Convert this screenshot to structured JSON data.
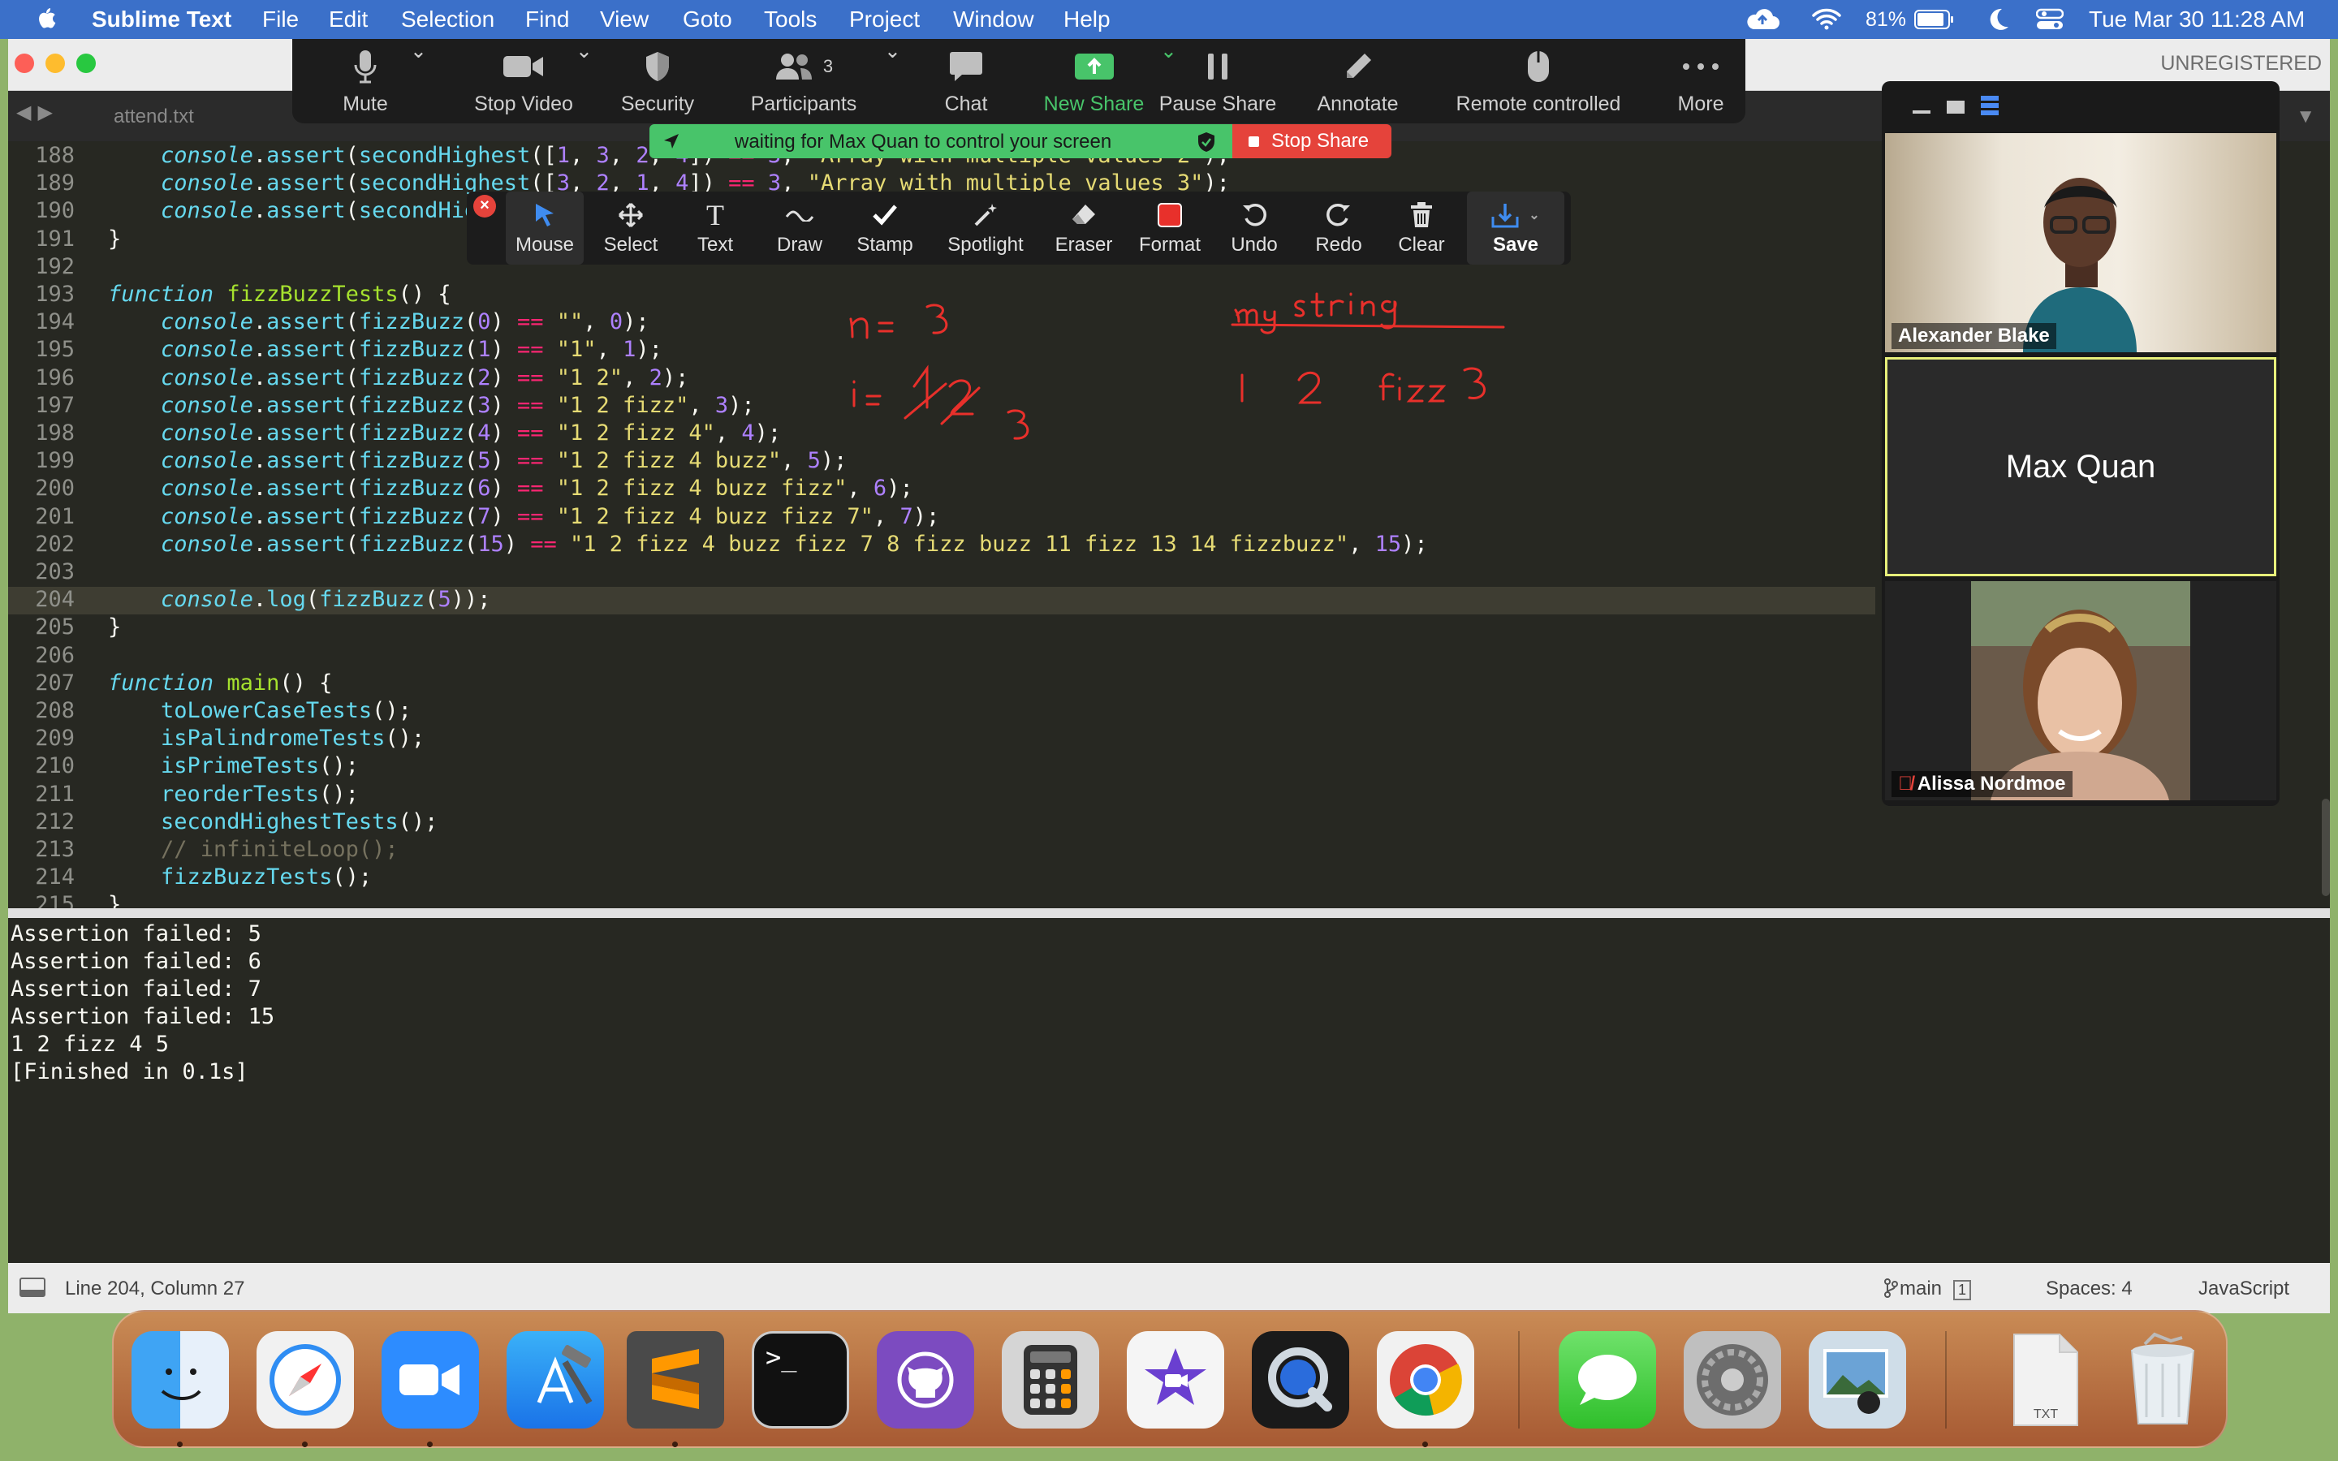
{
  "menubar": {
    "app": "Sublime Text",
    "items": [
      "File",
      "Edit",
      "Selection",
      "Find",
      "View",
      "Goto",
      "Tools",
      "Project",
      "Window",
      "Help"
    ],
    "battery": "81%",
    "datetime": "Tue Mar 30  11:28 AM"
  },
  "window": {
    "unregistered": "UNREGISTERED",
    "tab": "attend.txt"
  },
  "zoom_toolbar": {
    "mute": "Mute",
    "stop_video": "Stop Video",
    "security": "Security",
    "participants": "Participants",
    "participants_count": "3",
    "chat": "Chat",
    "new_share": "New Share",
    "pause_share": "Pause Share",
    "annotate": "Annotate",
    "remote_controlled": "Remote controlled",
    "more": "More"
  },
  "share_banner": {
    "waiting": "waiting for Max Quan to control your screen",
    "stop_share": "Stop Share"
  },
  "annotation_toolbar": {
    "mouse": "Mouse",
    "select": "Select",
    "text": "Text",
    "draw": "Draw",
    "stamp": "Stamp",
    "spotlight": "Spotlight",
    "eraser": "Eraser",
    "format": "Format",
    "undo": "Undo",
    "redo": "Redo",
    "clear": "Clear",
    "save": "Save"
  },
  "editor": {
    "lines": [
      {
        "n": "188",
        "html": "    <span class=\"kw\">console</span>.<span class=\"id\">assert</span>(<span class=\"id\">secondHighest</span>([<span class=\"num\">1</span>, <span class=\"num\">3</span>, <span class=\"num\">2</span>, <span class=\"num\">4</span>]) <span class=\"op\">==</span> <span class=\"num\">3</span>, <span class=\"str\">\"Array with multiple values 2\"</span>);"
      },
      {
        "n": "189",
        "html": "    <span class=\"kw\">console</span>.<span class=\"id\">assert</span>(<span class=\"id\">secondHighest</span>([<span class=\"num\">3</span>, <span class=\"num\">2</span>, <span class=\"num\">1</span>, <span class=\"num\">4</span>]) <span class=\"op\">==</span> <span class=\"num\">3</span>, <span class=\"str\">\"Array with multiple values 3\"</span>);"
      },
      {
        "n": "190",
        "html": "    <span class=\"kw\">console</span>.<span class=\"id\">assert</span>(<span class=\"id\">secondHighest</span>([<span class=\"num\">1</span>, <span class=\"num\">1</span>]) <span class=\"op\">==</span> <span class=\"num\">1</span>);"
      },
      {
        "n": "191",
        "html": "}"
      },
      {
        "n": "192",
        "html": ""
      },
      {
        "n": "193",
        "html": "<span class=\"kw\">function</span> <span class=\"fn\">fizzBuzzTests</span>() {"
      },
      {
        "n": "194",
        "html": "    <span class=\"kw\">console</span>.<span class=\"id\">assert</span>(<span class=\"id\">fizzBuzz</span>(<span class=\"num\">0</span>) <span class=\"op\">==</span> <span class=\"str\">\"\"</span>, <span class=\"num\">0</span>);"
      },
      {
        "n": "195",
        "html": "    <span class=\"kw\">console</span>.<span class=\"id\">assert</span>(<span class=\"id\">fizzBuzz</span>(<span class=\"num\">1</span>) <span class=\"op\">==</span> <span class=\"str\">\"1\"</span>, <span class=\"num\">1</span>);"
      },
      {
        "n": "196",
        "html": "    <span class=\"kw\">console</span>.<span class=\"id\">assert</span>(<span class=\"id\">fizzBuzz</span>(<span class=\"num\">2</span>) <span class=\"op\">==</span> <span class=\"str\">\"1 2\"</span>, <span class=\"num\">2</span>);"
      },
      {
        "n": "197",
        "html": "    <span class=\"kw\">console</span>.<span class=\"id\">assert</span>(<span class=\"id\">fizzBuzz</span>(<span class=\"num\">3</span>) <span class=\"op\">==</span> <span class=\"str\">\"1 2 fizz\"</span>, <span class=\"num\">3</span>);"
      },
      {
        "n": "198",
        "html": "    <span class=\"kw\">console</span>.<span class=\"id\">assert</span>(<span class=\"id\">fizzBuzz</span>(<span class=\"num\">4</span>) <span class=\"op\">==</span> <span class=\"str\">\"1 2 fizz 4\"</span>, <span class=\"num\">4</span>);"
      },
      {
        "n": "199",
        "html": "    <span class=\"kw\">console</span>.<span class=\"id\">assert</span>(<span class=\"id\">fizzBuzz</span>(<span class=\"num\">5</span>) <span class=\"op\">==</span> <span class=\"str\">\"1 2 fizz 4 buzz\"</span>, <span class=\"num\">5</span>);"
      },
      {
        "n": "200",
        "html": "    <span class=\"kw\">console</span>.<span class=\"id\">assert</span>(<span class=\"id\">fizzBuzz</span>(<span class=\"num\">6</span>) <span class=\"op\">==</span> <span class=\"str\">\"1 2 fizz 4 buzz fizz\"</span>, <span class=\"num\">6</span>);"
      },
      {
        "n": "201",
        "html": "    <span class=\"kw\">console</span>.<span class=\"id\">assert</span>(<span class=\"id\">fizzBuzz</span>(<span class=\"num\">7</span>) <span class=\"op\">==</span> <span class=\"str\">\"1 2 fizz 4 buzz fizz 7\"</span>, <span class=\"num\">7</span>);"
      },
      {
        "n": "202",
        "html": "    <span class=\"kw\">console</span>.<span class=\"id\">assert</span>(<span class=\"id\">fizzBuzz</span>(<span class=\"num\">15</span>) <span class=\"op\">==</span> <span class=\"str\">\"1 2 fizz 4 buzz fizz 7 8 fizz buzz 11 fizz 13 14 fizzbuzz\"</span>, <span class=\"num\">15</span>);"
      },
      {
        "n": "203",
        "html": ""
      },
      {
        "n": "204",
        "html": "    <span class=\"kw\">console</span>.<span class=\"id\">log</span>(<span class=\"id\">fizzBuzz</span>(<span class=\"num\">5</span>));",
        "current": true
      },
      {
        "n": "205",
        "html": "}"
      },
      {
        "n": "206",
        "html": ""
      },
      {
        "n": "207",
        "html": "<span class=\"kw\">function</span> <span class=\"fn\">main</span>() {"
      },
      {
        "n": "208",
        "html": "    <span class=\"id\">toLowerCaseTests</span>();"
      },
      {
        "n": "209",
        "html": "    <span class=\"id\">isPalindromeTests</span>();"
      },
      {
        "n": "210",
        "html": "    <span class=\"id\">isPrimeTests</span>();"
      },
      {
        "n": "211",
        "html": "    <span class=\"id\">reorderTests</span>();"
      },
      {
        "n": "212",
        "html": "    <span class=\"id\">secondHighestTests</span>();"
      },
      {
        "n": "213",
        "html": "    <span class=\"cm\">// infiniteLoop();</span>"
      },
      {
        "n": "214",
        "html": "    <span class=\"id\">fizzBuzzTests</span>();"
      },
      {
        "n": "215",
        "html": "}"
      }
    ]
  },
  "console": {
    "lines": [
      "Assertion failed: 5",
      "Assertion failed: 6",
      "Assertion failed: 7",
      "Assertion failed: 15",
      "1 2 fizz 4 5",
      "[Finished in 0.1s]"
    ]
  },
  "statusbar": {
    "position": "Line 204, Column 27",
    "branch": "main",
    "branch_count": "1",
    "spaces": "Spaces: 4",
    "syntax": "JavaScript"
  },
  "annotations": {
    "n_eq": "n = 3",
    "i_eq": "i = 1 2 3",
    "my_string": "my string",
    "seq": "1  2  fizz3"
  },
  "participants": [
    {
      "name": "Alexander Blake"
    },
    {
      "name": "Max Quan"
    },
    {
      "name": "Alissa Nordmoe"
    }
  ],
  "dock": {
    "txt_label": "TXT"
  },
  "colors": {
    "accent_green": "#48c46a",
    "stop_red": "#e5433b",
    "annotation_red": "#e8302b",
    "menubar_blue": "#3b70c9"
  }
}
